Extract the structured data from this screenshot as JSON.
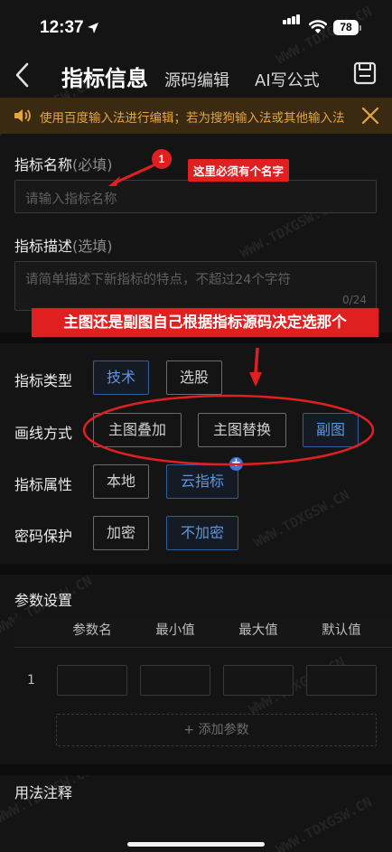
{
  "status": {
    "time": "12:37",
    "battery": "78"
  },
  "nav": {
    "title": "指标信息",
    "tabs": [
      "源码编辑",
      "AI写公式"
    ]
  },
  "notice": {
    "text": "使用百度输入法进行编辑；若为搜狗输入法或其他输入法"
  },
  "form": {
    "name_label": "指标名称",
    "name_required": "(必填)",
    "name_placeholder": "请输入指标名称",
    "desc_label": "指标描述",
    "desc_optional": "(选填)",
    "desc_placeholder": "请简单描述下新指标的特点，不超过24个字符",
    "desc_counter": "0/24"
  },
  "options": {
    "type_label": "指标类型",
    "type_options": [
      "技术",
      "选股"
    ],
    "type_selected": "技术",
    "draw_label": "画线方式",
    "draw_options": [
      "主图叠加",
      "主图替换",
      "副图"
    ],
    "draw_selected": "副图",
    "attr_label": "指标属性",
    "attr_options": [
      "本地",
      "云指标"
    ],
    "attr_selected": "云指标",
    "pwd_label": "密码保护",
    "pwd_options": [
      "加密",
      "不加密"
    ],
    "pwd_selected": "不加密"
  },
  "params": {
    "title": "参数设置",
    "headers": [
      "参数名",
      "最小值",
      "最大值",
      "默认值"
    ],
    "row_index": "1",
    "add_label": "+ 添加参数"
  },
  "usage": {
    "title": "用法注释"
  },
  "annotations": {
    "badge": "1",
    "name_hint": "这里必须有个名字",
    "draw_hint": "主图还是副图自己根据指标源码决定选那个"
  },
  "watermark": "WWW.TDXGSW.CN",
  "colors": {
    "accent_blue": "#5e95e0",
    "notice_text": "#e5a544",
    "annotation_red": "#e02020"
  }
}
